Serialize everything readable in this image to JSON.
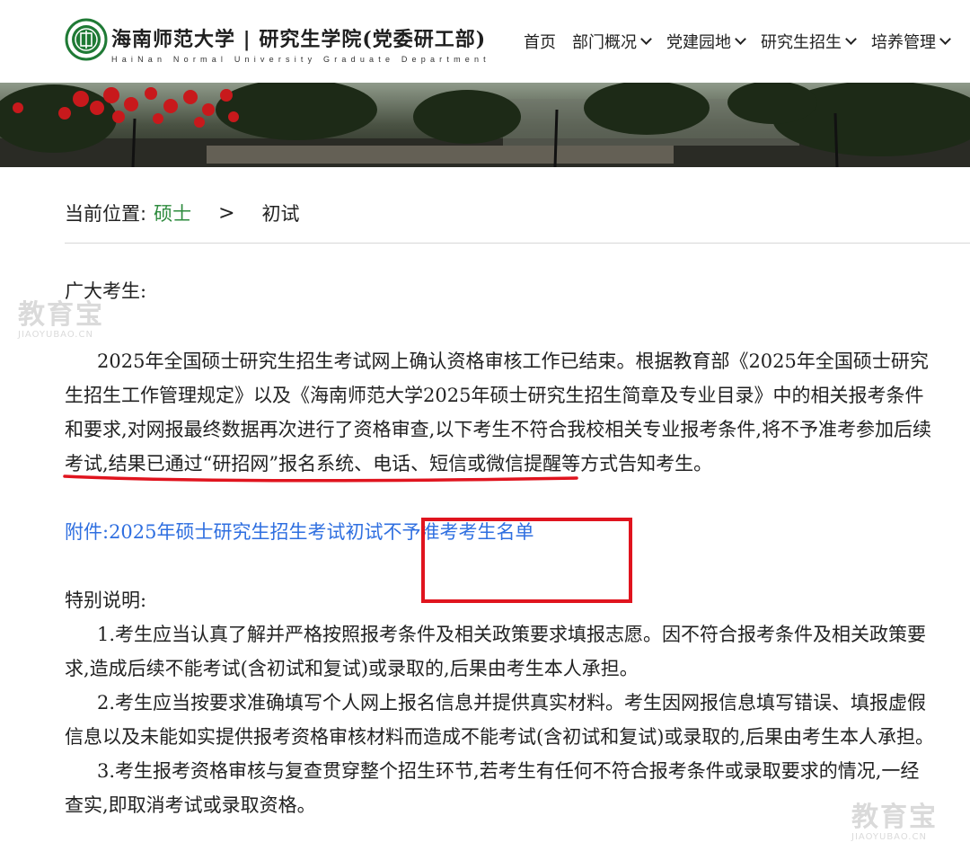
{
  "header": {
    "brand_cn": "海南师范大学 | 研究生学院(党委研工部)",
    "brand_en": "HaiNan Normal University Graduate Department",
    "nav": [
      {
        "label": "首页",
        "has_dropdown": false
      },
      {
        "label": "部门概况",
        "has_dropdown": true
      },
      {
        "label": "党建园地",
        "has_dropdown": true
      },
      {
        "label": "研究生招生",
        "has_dropdown": true
      },
      {
        "label": "培养管理",
        "has_dropdown": true
      }
    ]
  },
  "breadcrumb": {
    "prefix": "当前位置:",
    "link": "硕士",
    "separator": ">",
    "current": "初试"
  },
  "article": {
    "greeting": "广大考生:",
    "intro": "2025年全国硕士研究生招生考试网上确认资格审核工作已结束。根据教育部《2025年全国硕士研究生招生工作管理规定》以及《海南师范大学2025年硕士研究生招生简章及专业目录》中的相关报考条件和要求,对网报最终数据再次进行了资格审查,以下考生不符合我校相关专业报考条件,将不予准考参加后续考试,结果已通过“研招网”报名系统、电话、短信或微信提醒等方式告知考生。",
    "attachment": "附件:2025年硕士研究生招生考试初试不予准考考生名单",
    "special_title": "特别说明:",
    "items": [
      "1.考生应当认真了解并严格按照报考条件及相关政策要求填报志愿。因不符合报考条件及相关政策要求,造成后续不能考试(含初试和复试)或录取的,后果由考生本人承担。",
      "2.考生应当按要求准确填写个人网上报名信息并提供真实材料。考生因网报信息填写错误、填报虚假信息以及未能如实提供报考资格审核材料而造成不能考试(含初试和复试)或录取的,后果由考生本人承担。",
      "3.考生报考资格审核与复查贯穿整个招生环节,若考生有任何不符合报考条件或录取要求的情况,一经查实,即取消考试或录取资格。"
    ]
  },
  "watermark": {
    "brand": "教育宝",
    "domain": "JIAOYUBAO.CN"
  },
  "colors": {
    "link_green": "#2e8b3e",
    "link_blue": "#2f6fe0",
    "annotation_red": "#e0141e"
  }
}
